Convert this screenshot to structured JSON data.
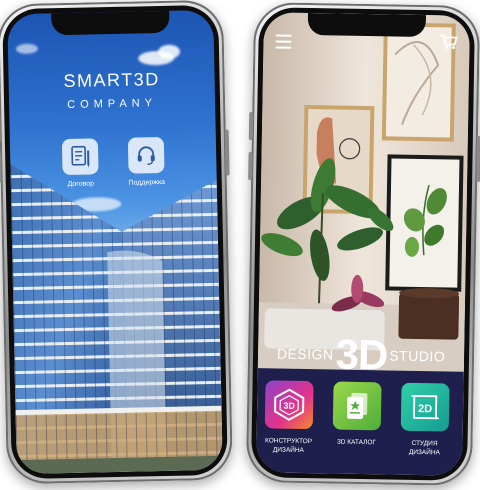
{
  "left_app": {
    "logo": {
      "title": "SMART3D",
      "subtitle": "COMPANY"
    },
    "tiles": [
      {
        "label": "Договор",
        "icon": "document-pen-icon"
      },
      {
        "label": "Поддержка",
        "icon": "headset-icon"
      }
    ]
  },
  "right_app": {
    "banner": {
      "left": "DESIGN",
      "center": "3D",
      "right": "STUDIO"
    },
    "buttons": [
      {
        "label_line1": "КОНСТРУКТОР",
        "label_line2": "ДИЗАЙНА",
        "icon": "3d-cube-icon",
        "color": "#d63a8c"
      },
      {
        "label_line1": "3D КАТАЛОГ",
        "label_line2": "",
        "icon": "catalog-icon",
        "color": "#6cc04a"
      },
      {
        "label_line1": "СТУДИЯ",
        "label_line2": "ДИЗАЙНА",
        "icon": "2d-plan-icon",
        "color": "#1fae9c"
      }
    ],
    "icons": {
      "menu": "hamburger-menu-icon",
      "cart": "cart-icon"
    }
  }
}
